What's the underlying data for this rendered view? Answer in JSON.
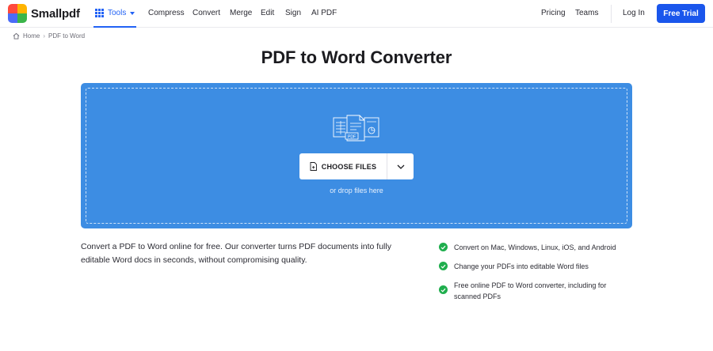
{
  "brand": {
    "name": "Smallpdf",
    "colors": [
      "#ff4a3d",
      "#ffb400",
      "#3bb54a",
      "#4b6cf7"
    ]
  },
  "header": {
    "tools_label": "Tools",
    "nav": [
      "Compress",
      "Convert",
      "Merge",
      "Edit",
      "Sign",
      "AI PDF"
    ],
    "right_nav": [
      "Pricing",
      "Teams"
    ],
    "login_label": "Log In",
    "trial_label": "Free Trial"
  },
  "breadcrumb": {
    "home": "Home",
    "current": "PDF to Word"
  },
  "page": {
    "title": "PDF to Word Converter"
  },
  "upload": {
    "choose_label": "CHOOSE FILES",
    "drop_hint": "or drop files here",
    "illustration_label": "PDF"
  },
  "description": "Convert a PDF to Word online for free. Our converter turns PDF documents into fully editable Word docs in seconds, without compromising quality.",
  "features": [
    "Convert on Mac, Windows, Linux, iOS, and Android",
    "Change your PDFs into editable Word files",
    "Free online PDF to Word converter, including for scanned PDFs"
  ],
  "colors": {
    "accent": "#2262f5",
    "cta": "#1a56ec",
    "dropzone": "#3d8de3",
    "check": "#1fae4d"
  }
}
